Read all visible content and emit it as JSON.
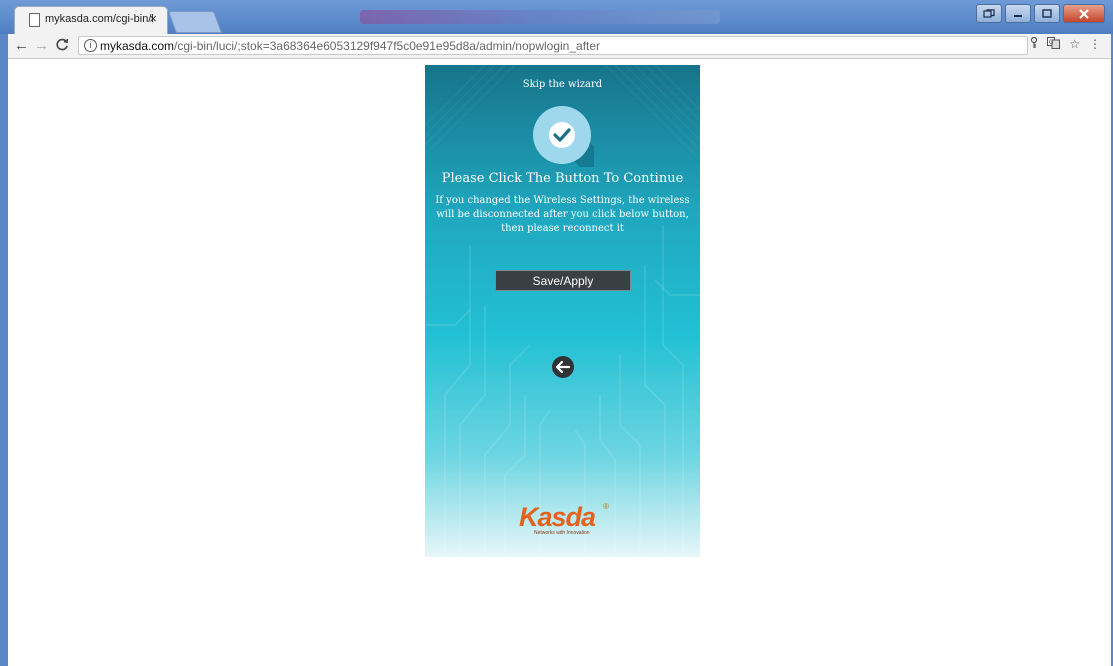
{
  "browser": {
    "tab_title": "mykasda.com/cgi-bin/l",
    "tab_close": "×",
    "url_host": "mykasda.com",
    "url_path": "/cgi-bin/luci/;stok=3a68364e6053129f947f5c0e91e95d8a/admin/nopwlogin_after",
    "icons": [
      "back-arrow-icon",
      "forward-arrow-icon",
      "reload-icon",
      "info-icon",
      "key-icon",
      "translate-icon",
      "star-icon",
      "menu-icon"
    ]
  },
  "wizard": {
    "skip_link": "Skip the wizard",
    "heading": "Please Click The Button To Continue",
    "note": "If you changed the Wireless Settings, the wireless will be disconnected after you click below button, then please reconnect it",
    "save_button": "Save/Apply"
  },
  "logo": {
    "name": "Kasda",
    "registered": "®",
    "tagline": "Networks with Innovation"
  },
  "colors": {
    "panel_top": "#17748a",
    "panel_mid": "#22c0d4",
    "button_bg": "#3a3f44",
    "logo": "#e4611e",
    "window_frame": "#5b87c6"
  }
}
